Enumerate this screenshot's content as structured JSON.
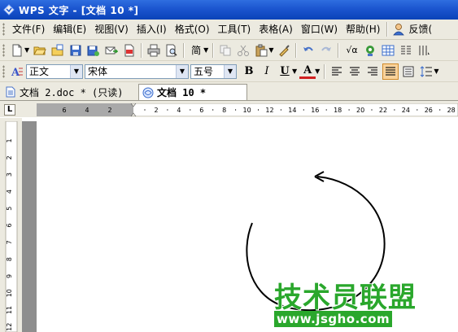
{
  "window": {
    "title": "WPS 文字 - [文档 10 *]"
  },
  "menu": {
    "items": [
      {
        "label": "文件(F)"
      },
      {
        "label": "编辑(E)"
      },
      {
        "label": "视图(V)"
      },
      {
        "label": "插入(I)"
      },
      {
        "label": "格式(O)"
      },
      {
        "label": "工具(T)"
      },
      {
        "label": "表格(A)"
      },
      {
        "label": "窗口(W)"
      },
      {
        "label": "帮助(H)"
      }
    ],
    "feedback_label": "反馈("
  },
  "toolbar": {
    "simplified_label": "简",
    "formula_label": "√α",
    "icons": [
      "new-doc-icon",
      "open-folder-icon",
      "open-recent-icon",
      "save-icon",
      "save-as-icon",
      "email-icon",
      "pdf-icon",
      "print-icon",
      "print-preview-icon",
      "copy-icon",
      "cut-icon",
      "paste-icon",
      "format-painter-icon",
      "undo-icon",
      "redo-icon",
      "insert-table-icon",
      "columns-icon"
    ]
  },
  "format_bar": {
    "style_value": "正文",
    "font_value": "宋体",
    "size_value": "五号",
    "bold_label": "B",
    "italic_label": "I",
    "underline_label": "U",
    "font_color_label": "A"
  },
  "tabs": [
    {
      "label": "文档 2.doc * (只读)",
      "active": false
    },
    {
      "label": "文档 10 *",
      "active": true
    }
  ],
  "ruler": {
    "horizontal_left": [
      "6",
      "4",
      "2"
    ],
    "horizontal_right": [
      "2",
      "4",
      "6",
      "8",
      "10",
      "12",
      "14",
      "16",
      "18",
      "20",
      "22",
      "24",
      "26",
      "28"
    ],
    "vertical": [
      "1",
      "2",
      "3",
      "4",
      "5",
      "6",
      "7",
      "8",
      "9",
      "10",
      "11",
      "12"
    ],
    "corner_label": "L"
  },
  "watermark": {
    "main": "技术员联盟",
    "url": "www.jsgho.com"
  },
  "colors": {
    "title_bar": "#1b55cf",
    "watermark_green": "#2aa72c",
    "active_button": "#f9d29a"
  }
}
